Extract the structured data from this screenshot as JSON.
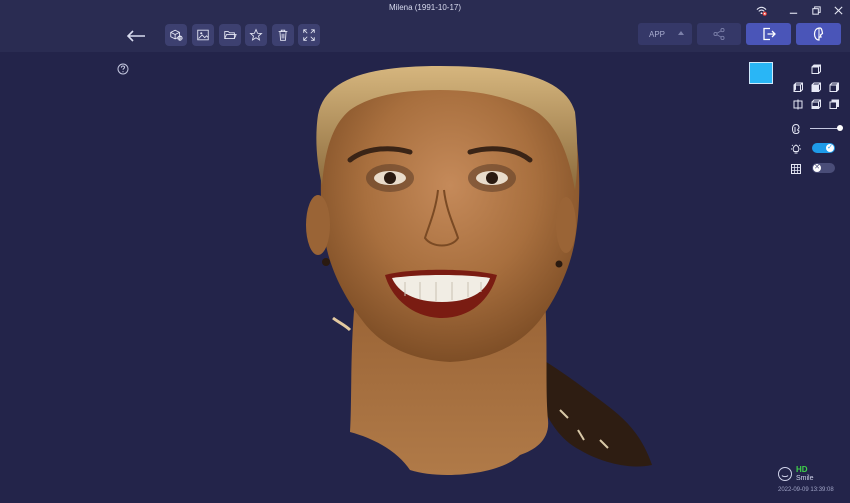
{
  "window": {
    "title": "Milena (1991-10-17)"
  },
  "toolbar": {
    "app_label": "APP",
    "tools": [
      {
        "icon": "cube-scan-icon"
      },
      {
        "icon": "image-icon"
      },
      {
        "icon": "folder-open-icon"
      },
      {
        "icon": "star-icon"
      },
      {
        "icon": "trash-icon"
      },
      {
        "icon": "fullscreen-icon"
      }
    ]
  },
  "viewer": {
    "background_color": "#23244a",
    "color_swatch": "#29b6f6",
    "opacity_slider_value": 1.0,
    "lighting_toggle": true,
    "grid_toggle": false
  },
  "capture": {
    "quality": "HD",
    "expression": "Smile",
    "timestamp": "2022-09-09 13:39:08"
  },
  "colors": {
    "accent": "#4a55b8",
    "toggle_on": "#1e9be9",
    "hd_green": "#3fd14a"
  }
}
